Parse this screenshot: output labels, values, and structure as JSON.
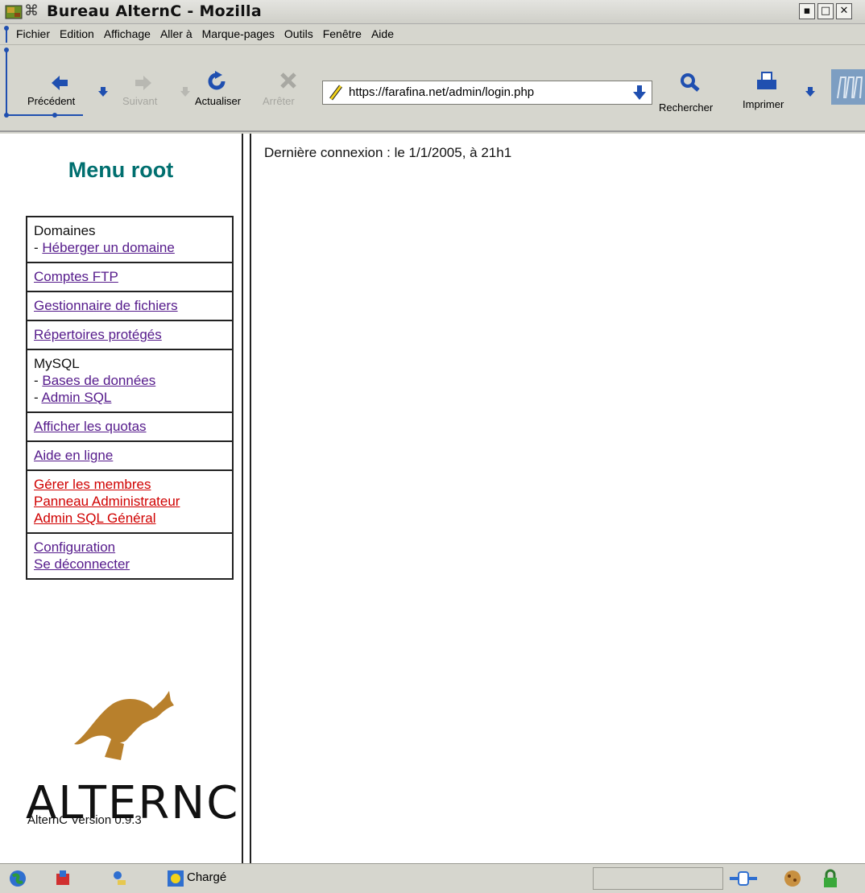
{
  "window": {
    "title": "Bureau AlternC - Mozilla",
    "pin": "⌘"
  },
  "menubar": {
    "items": [
      "Fichier",
      "Edition",
      "Affichage",
      "Aller à",
      "Marque-pages",
      "Outils",
      "Fenêtre",
      "Aide"
    ]
  },
  "navbar": {
    "back": "Précédent",
    "forward": "Suivant",
    "reload": "Actualiser",
    "stop": "Arrêter",
    "url": "https://farafina.net/admin/login.php",
    "search": "Rechercher",
    "print": "Imprimer"
  },
  "sidebar": {
    "title": "Menu root",
    "domains_heading": "Domaines",
    "host_domain": "Héberger un domaine",
    "ftp": "Comptes FTP",
    "file_manager": "Gestionnaire de fichiers",
    "protected_dirs": "Répertoires protégés",
    "mysql_heading": "MySQL",
    "databases": "Bases de données",
    "admin_sql": "Admin SQL",
    "quotas": "Afficher les quotas",
    "help": "Aide en ligne",
    "manage_members": "Gérer les membres",
    "admin_panel": "Panneau Administrateur",
    "admin_sql_general": "Admin SQL Général",
    "configuration": "Configuration",
    "logout": "Se déconnecter",
    "logo_text": "ALTERNC",
    "version": "AlternC Version 0.9.3"
  },
  "content": {
    "last_connection": "Dernière connexion : le 1/1/2005, à 21h1"
  },
  "status": {
    "text": "Chargé"
  },
  "colors": {
    "title_teal": "#006f6f",
    "link_visited": "#551a8b",
    "link_admin": "#d00000",
    "chrome": "#d6d6ce"
  }
}
